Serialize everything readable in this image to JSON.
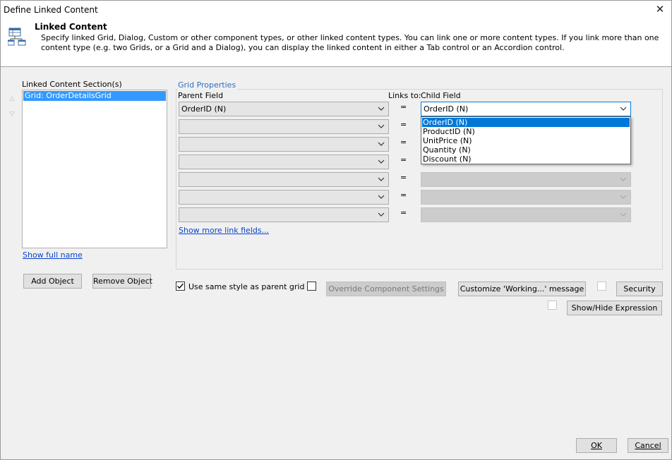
{
  "window": {
    "title": "Define Linked Content",
    "close_glyph": "✕"
  },
  "header": {
    "title": "Linked Content",
    "description": "Specify linked Grid, Dialog, Custom or other component types, or other linked content types. You can link one or more content types. If you link more than one content type (e.g. two Grids, or a Grid and a Dialog), you can display the linked content in either a Tab control or an Accordion control.",
    "icon": "linked-content-icon"
  },
  "sections": {
    "label": "Linked Content Section(s)",
    "items": [
      "Grid: OrderDetailsGrid"
    ],
    "show_full_name": "Show full name",
    "add_object": "Add Object",
    "remove_object": "Remove Object"
  },
  "grid_properties": {
    "title": "Grid Properties",
    "parent_field_label": "Parent Field",
    "links_to_label": "Links to:",
    "child_field_label": "Child Field",
    "equals": "=",
    "parent_values": [
      "OrderID (N)",
      "",
      "",
      "",
      "",
      "",
      ""
    ],
    "child_values": [
      "OrderID (N)",
      "",
      "",
      "",
      "",
      "",
      ""
    ],
    "child_dropdown_options": [
      "OrderID (N)",
      "ProductID (N)",
      "UnitPrice (N)",
      "Quantity (N)",
      "Discount (N)"
    ],
    "child_dropdown_selected": "OrderID (N)",
    "show_more": "Show more link fields..."
  },
  "options": {
    "use_same_style": "Use same style as parent grid",
    "use_same_style_checked": true,
    "override_component_settings": "Override Component Settings",
    "override_checked": false,
    "customize_working": "Customize 'Working...' message",
    "security": "Security",
    "show_hide_expression": "Show/Hide Expression"
  },
  "footer": {
    "ok": "OK",
    "cancel": "Cancel"
  },
  "colors": {
    "selection": "#3399ff",
    "link": "#0a44cc",
    "group_title": "#2f6fc6",
    "focus": "#0078d7"
  }
}
